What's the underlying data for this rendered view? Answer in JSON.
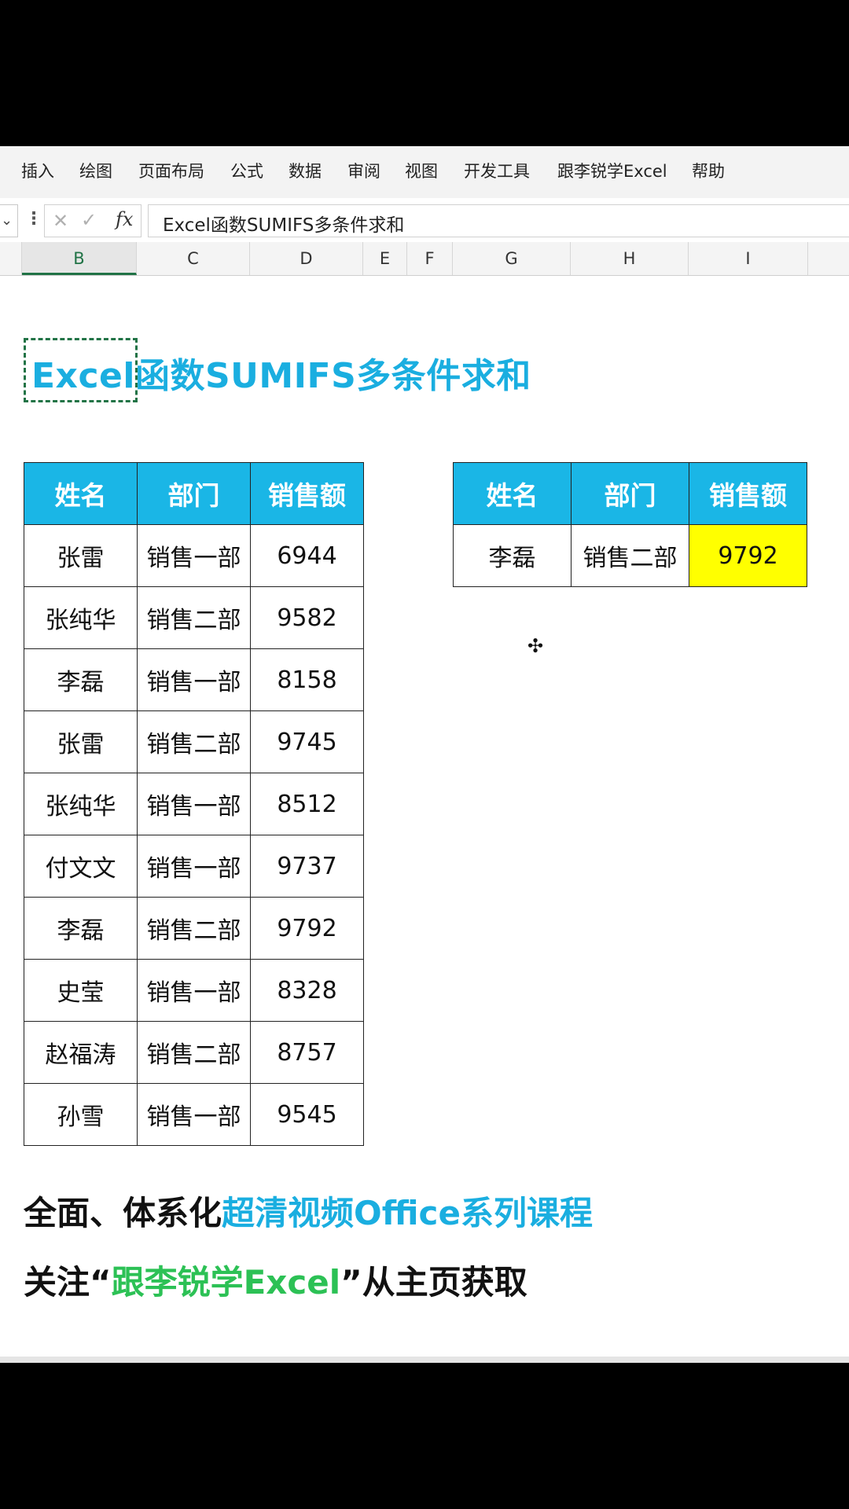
{
  "ribbon": {
    "tabs": [
      "插入",
      "绘图",
      "页面布局",
      "公式",
      "数据",
      "审阅",
      "视图",
      "开发工具",
      "跟李锐学Excel",
      "帮助"
    ]
  },
  "formula_bar": {
    "content": "Excel函数SUMIFS多条件求和",
    "fx_label": "fx"
  },
  "columns": [
    "B",
    "C",
    "D",
    "E",
    "F",
    "G",
    "H",
    "I"
  ],
  "sheet": {
    "title": "Excel函数SUMIFS多条件求和",
    "main_table": {
      "headers": [
        "姓名",
        "部门",
        "销售额"
      ],
      "rows": [
        [
          "张雷",
          "销售一部",
          "6944"
        ],
        [
          "张纯华",
          "销售二部",
          "9582"
        ],
        [
          "李磊",
          "销售一部",
          "8158"
        ],
        [
          "张雷",
          "销售二部",
          "9745"
        ],
        [
          "张纯华",
          "销售一部",
          "8512"
        ],
        [
          "付文文",
          "销售一部",
          "9737"
        ],
        [
          "李磊",
          "销售二部",
          "9792"
        ],
        [
          "史莹",
          "销售一部",
          "8328"
        ],
        [
          "赵福涛",
          "销售二部",
          "8757"
        ],
        [
          "孙雪",
          "销售一部",
          "9545"
        ]
      ]
    },
    "criteria_table": {
      "headers": [
        "姓名",
        "部门",
        "销售额"
      ],
      "row": [
        "李磊",
        "销售二部",
        "9792"
      ],
      "highlight_color": "#ffff00"
    }
  },
  "promo": {
    "line1_black": "全面、体系化",
    "line1_blue": "超清视频Office系列课程",
    "line2_prefix": "关注“",
    "line2_green": "跟李锐学Excel",
    "line2_suffix": "”从主页获取"
  },
  "colors": {
    "accent_blue": "#1aaee0",
    "header_fill": "#1ab6e6",
    "green": "#2cc155",
    "excel_green": "#217346"
  }
}
